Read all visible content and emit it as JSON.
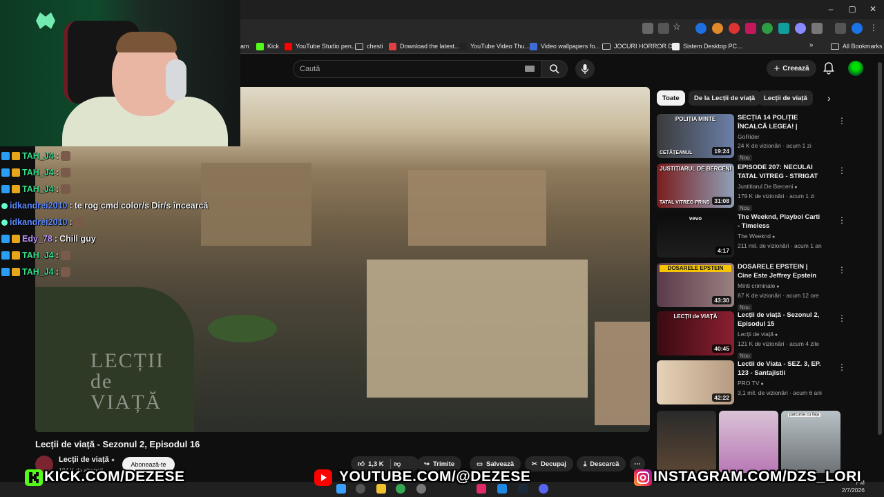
{
  "bookmarks": [
    {
      "label": "am",
      "color": "#888"
    },
    {
      "label": "Kick",
      "color": "#53fc18"
    },
    {
      "label": "YouTube Studio pen...",
      "color": "#ff0000"
    },
    {
      "label": "chesti",
      "color": "folder"
    },
    {
      "label": "Download the latest...",
      "color": "#e04040"
    },
    {
      "label": "YouTube Video Thu...",
      "color": "#222"
    },
    {
      "label": "Video wallpapers fo...",
      "color": "#3d6bd8"
    },
    {
      "label": "JOCURI HORROR D...",
      "color": "folder"
    },
    {
      "label": "Sistem Desktop PC...",
      "color": "#eee"
    }
  ],
  "all_bookmarks": "All Bookmarks",
  "search": {
    "placeholder": "Caută"
  },
  "header": {
    "create": "Creează"
  },
  "chat": [
    {
      "user": "TAH_J4",
      "color": "#34e08a",
      "msg": ""
    },
    {
      "user": "TAH_J4",
      "color": "#34e08a",
      "msg": ""
    },
    {
      "user": "TAH_J4",
      "color": "#34e08a",
      "msg": ""
    },
    {
      "user": "idkandrei2010",
      "color": "#5c8cff",
      "msg": " te rog cmd color/s Dir/s încearcă"
    },
    {
      "user": "idkandrei2010",
      "color": "#5c8cff",
      "msg": ""
    },
    {
      "user": "Edy_78",
      "color": "#c09cff",
      "msg": " Chill guy"
    },
    {
      "user": "TAH_J4",
      "color": "#34e08a",
      "msg": ""
    },
    {
      "user": "TAH_J4",
      "color": "#34e08a",
      "msg": ""
    }
  ],
  "video": {
    "title": "Lecții de viață - Sezonul 2, Episodul 16",
    "watermark": "LECȚII de VIAȚĂ"
  },
  "channel": {
    "name": "Lecții de viață",
    "subscribe": "Abonează-te",
    "subs": "184 K de abonați"
  },
  "actions": {
    "likes": "1,3 K",
    "share": "Trimite",
    "save": "Salvează",
    "clip": "Decupaj",
    "download": "Descarcă"
  },
  "chips": [
    "Toate",
    "De la Lecții de viață",
    "Lecții de viață"
  ],
  "recs": [
    {
      "title": "SECȚIA 14 POLIȚIE ÎNCALCĂ LEGEA! | Săptămâna pe ghido...",
      "channel": "GoRider",
      "meta": "24 K de vizionări · acum 1 zi",
      "new": "Nou",
      "duration": "19:24",
      "thumb_text": "POLIȚIA MINTE",
      "thumb_text2": "CETĂȚEANUL",
      "verified": false
    },
    {
      "title": "EPISODE 207: NECULAI TATAL VITREG - STRIGAT DE AJUTOR",
      "channel": "Justitiarul De Berceni",
      "meta": "179 K de vizionări · acum 1 zi",
      "new": "Nou",
      "duration": "31:08",
      "thumb_text": "JUSTIȚIARUL DE BERCENI",
      "thumb_text2": "TATAL VITREG PRINS",
      "verified": true
    },
    {
      "title": "The Weeknd, Playboi Carti - Timeless",
      "channel": "The Weeknd",
      "meta": "211 mil. de vizionări · acum 1 an",
      "new": "",
      "duration": "4:17",
      "thumb_text": "vevo",
      "thumb_text2": "",
      "verified": true
    },
    {
      "title": "DOSARELE EPSTEIN | Cine Este Jeffrey Epstein Și Ce Se ...",
      "channel": "Minti criminale",
      "meta": "87 K de vizionări · acum 12 ore",
      "new": "Nou",
      "duration": "43:30",
      "thumb_text": "DOSARELE EPSTEIN",
      "thumb_text2": "",
      "verified": true
    },
    {
      "title": "Lecții de viață - Sezonul 2, Episodul 15",
      "channel": "Lecții de viață",
      "meta": "121 K de vizionări · acum 4 zile",
      "new": "Nou",
      "duration": "40:45",
      "thumb_text": "LECȚII de VIAȚĂ",
      "thumb_text2": "",
      "verified": true
    },
    {
      "title": "Lectii de Viata - SEZ. 3, EP. 123 - Santajistii",
      "channel": "PRO TV",
      "meta": "3,1 mil. de vizionări · acum 6 ani",
      "new": "",
      "duration": "42:22",
      "thumb_text": "",
      "thumb_text2": "",
      "verified": true
    }
  ],
  "shorts_caption": "parcurse cu fața",
  "banner": {
    "kick": "KICK.COM/DEZESE",
    "youtube": "YOUTUBE.COM/@DEZESE",
    "instagram": "INSTAGRAM.COM/DZS_LORI"
  },
  "clock": {
    "time": "PM",
    "date": "2/7/2026"
  },
  "colors": {
    "kick": "#53fc18",
    "youtube": "#ff0000",
    "accent": "#3ea6ff"
  }
}
